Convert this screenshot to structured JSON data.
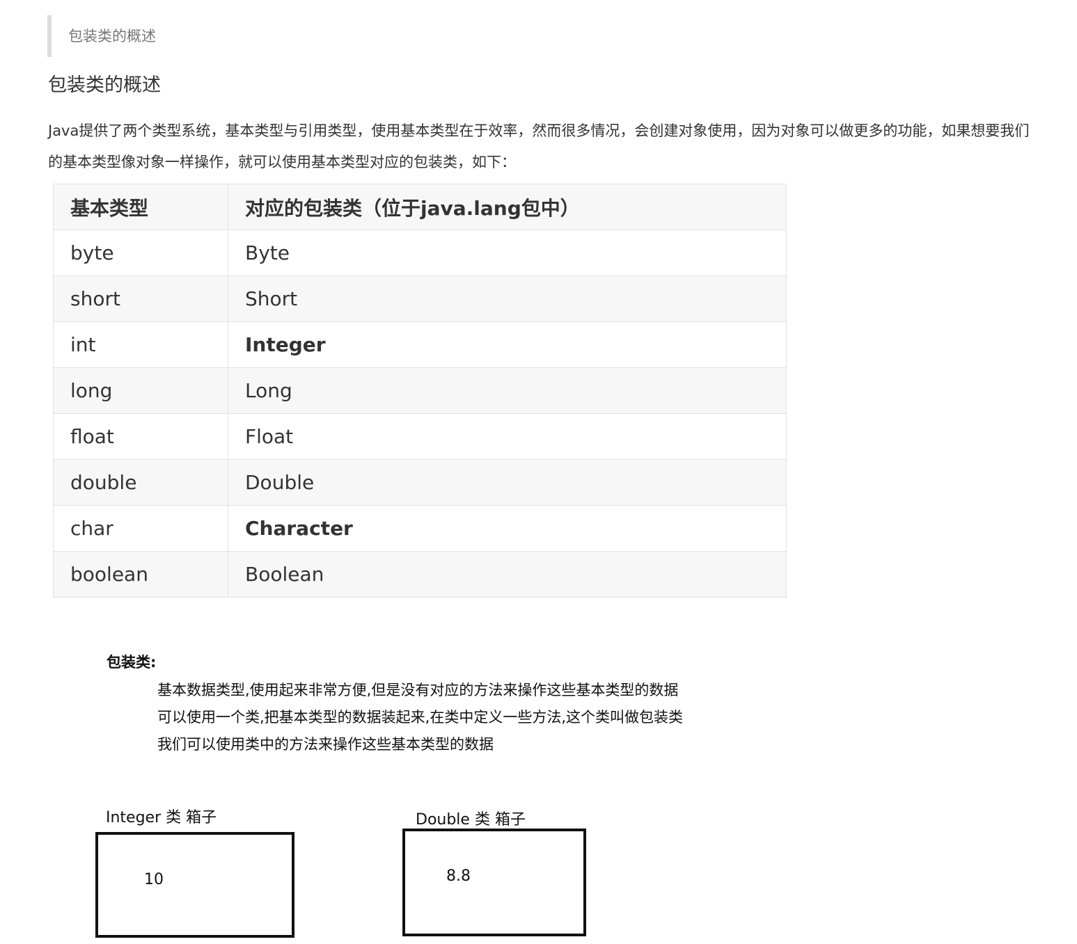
{
  "blockquote": "包装类的概述",
  "heading": "包装类的概述",
  "paragraph": "Java提供了两个类型系统，基本类型与引用类型，使用基本类型在于效率，然而很多情况，会创建对象使用，因为对象可以做更多的功能，如果想要我们的基本类型像对象一样操作，就可以使用基本类型对应的包装类，如下：",
  "table": {
    "headers": [
      "基本类型",
      "对应的包装类（位于java.lang包中）"
    ],
    "rows": [
      {
        "primitive": "byte",
        "wrapper": "Byte"
      },
      {
        "primitive": "short",
        "wrapper": "Short"
      },
      {
        "primitive": "int",
        "wrapper": "Integer"
      },
      {
        "primitive": "long",
        "wrapper": "Long"
      },
      {
        "primitive": "float",
        "wrapper": "Float"
      },
      {
        "primitive": "double",
        "wrapper": "Double"
      },
      {
        "primitive": "char",
        "wrapper": "Character"
      },
      {
        "primitive": "boolean",
        "wrapper": "Boolean"
      }
    ]
  },
  "note": {
    "title": "包装类:",
    "lines": [
      "基本数据类型,使用起来非常方便,但是没有对应的方法来操作这些基本类型的数据",
      "可以使用一个类,把基本类型的数据装起来,在类中定义一些方法,这个类叫做包装类",
      "我们可以使用类中的方法来操作这些基本类型的数据"
    ]
  },
  "diagram": {
    "integer_box": {
      "label": "Integer 类 箱子",
      "value": "10"
    },
    "double_box": {
      "label": "Double 类 箱子",
      "value": "8.8"
    }
  }
}
